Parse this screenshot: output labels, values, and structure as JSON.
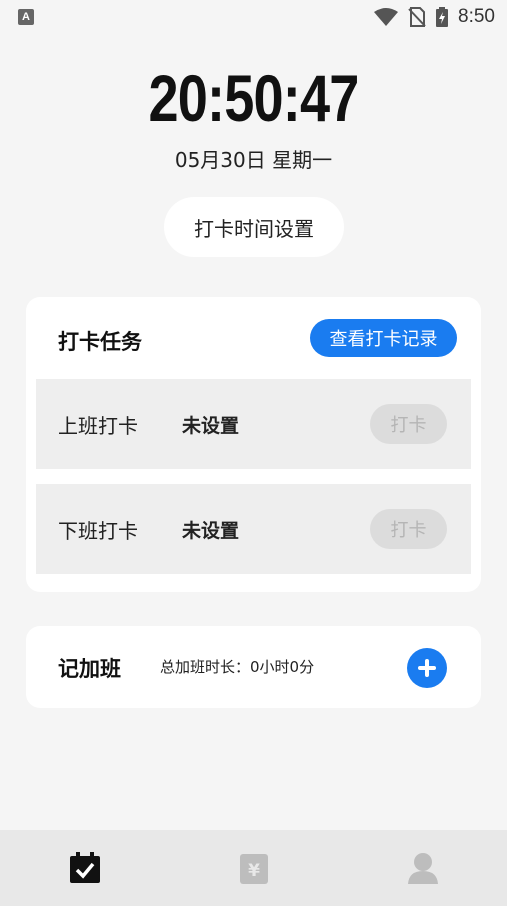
{
  "status_bar": {
    "indicator": "A",
    "time": "8:50",
    "icons": [
      "wifi-icon",
      "no-sim-icon",
      "battery-charging-icon"
    ]
  },
  "clock": {
    "time": "20:50:47",
    "date": "05月30日 星期一"
  },
  "time_setting_button": "打卡时间设置",
  "task_card": {
    "title": "打卡任务",
    "record_button": "查看打卡记录",
    "rows": [
      {
        "name": "上班打卡",
        "status": "未设置",
        "button": "打卡"
      },
      {
        "name": "下班打卡",
        "status": "未设置",
        "button": "打卡"
      }
    ]
  },
  "overtime_card": {
    "title": "记加班",
    "total": "总加班时长：0小时0分",
    "add_icon": "plus-circle-icon"
  },
  "tab_bar": {
    "tabs": [
      {
        "icon": "calendar-check-icon",
        "active": true
      },
      {
        "icon": "yen-icon",
        "active": false
      },
      {
        "icon": "person-icon",
        "active": false
      }
    ],
    "active_color": "#111111",
    "inactive_color": "#bdbdbd"
  },
  "colors": {
    "accent": "#1a7cf0",
    "background": "#f5f5f5"
  }
}
